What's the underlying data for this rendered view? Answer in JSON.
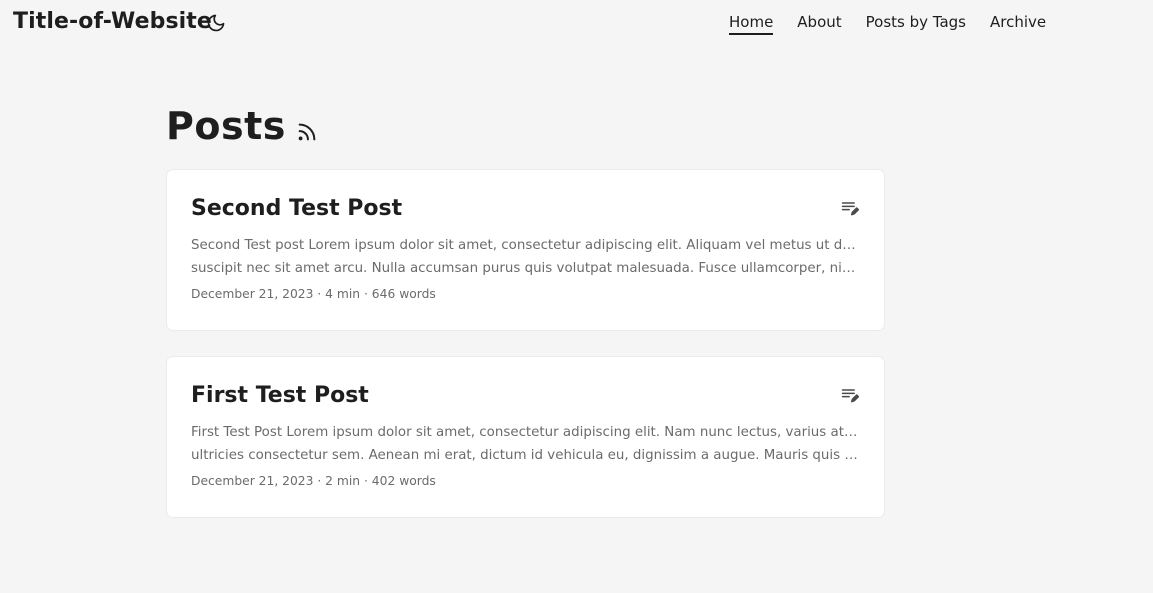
{
  "site": {
    "title": "Title-of-Website",
    "theme_toggle_icon": "moon-icon"
  },
  "nav": {
    "items": [
      {
        "label": "Home",
        "active": true
      },
      {
        "label": "About",
        "active": false
      },
      {
        "label": "Posts by Tags",
        "active": false
      },
      {
        "label": "Archive",
        "active": false
      }
    ]
  },
  "main": {
    "page_title": "Posts",
    "rss_icon": "rss-icon",
    "posts": [
      {
        "title": "Second Test Post",
        "summary_line1": "Second Test post Lorem ipsum dolor sit amet, consectetur adipiscing elit. Aliquam vel metus ut dui tempor",
        "summary_line2": "suscipit nec sit amet arcu. Nulla accumsan purus quis volutpat malesuada. Fusce ullamcorper, nisl sed…",
        "meta": "December 21, 2023 · 4 min · 646 words",
        "edit_icon": "edit-list-icon"
      },
      {
        "title": "First Test Post",
        "summary_line1": "First Test Post Lorem ipsum dolor sit amet, consectetur adipiscing elit. Nam nunc lectus, varius at dui nec,",
        "summary_line2": "ultricies consectetur sem. Aenean mi erat, dictum id vehicula eu, dignissim a augue. Mauris quis libero…",
        "meta": "December 21, 2023 · 2 min · 402 words",
        "edit_icon": "edit-list-icon"
      }
    ]
  },
  "colors": {
    "background": "#f5f5f5",
    "card": "#ffffff",
    "text_primary": "#1e1e1e",
    "text_secondary": "#6b6b6b"
  }
}
